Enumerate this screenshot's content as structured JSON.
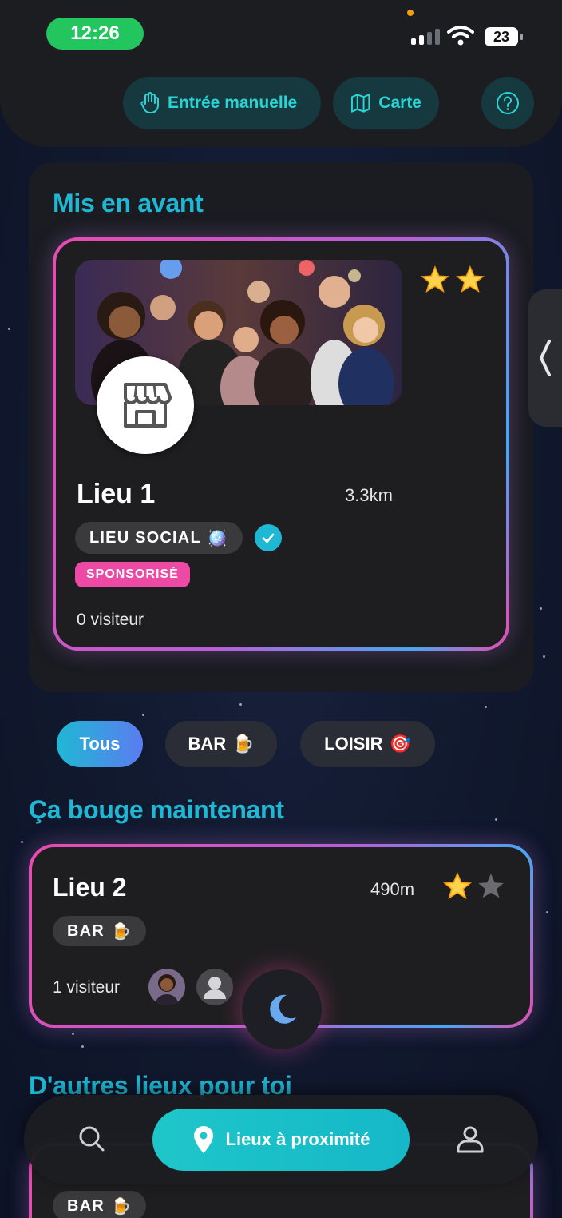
{
  "status_bar": {
    "time": "12:26",
    "battery": "23"
  },
  "header": {
    "manual_entry_label": "Entrée manuelle",
    "map_label": "Carte"
  },
  "featured": {
    "title": "Mis en avant",
    "venue": {
      "name": "Lieu 1",
      "distance": "3.3km",
      "rating": 2,
      "rating_max": 2,
      "category": "LIEU SOCIAL",
      "category_emoji": "🪩",
      "verified": true,
      "sponsored_label": "SPONSORISÉ",
      "visitors": "0 visiteur"
    }
  },
  "filters": {
    "tous": "Tous",
    "bar": "BAR",
    "bar_emoji": "🍺",
    "loisir": "LOISIR",
    "loisir_emoji": "🎯"
  },
  "now": {
    "title": "Ça bouge maintenant",
    "venue": {
      "name": "Lieu 2",
      "distance": "490m",
      "rating": 1,
      "rating_max": 2,
      "category": "BAR",
      "category_emoji": "🍺",
      "visitors": "1 visiteur"
    }
  },
  "others": {
    "title": "D'autres lieux pour toi",
    "venue": {
      "category": "BAR",
      "category_emoji": "🍺"
    }
  },
  "bottom_nav": {
    "nearby_label": "Lieux à proximité"
  },
  "colors": {
    "accent_cyan": "#1fb8d4",
    "accent_pink": "#ec4aa5",
    "background": "#121a30"
  }
}
